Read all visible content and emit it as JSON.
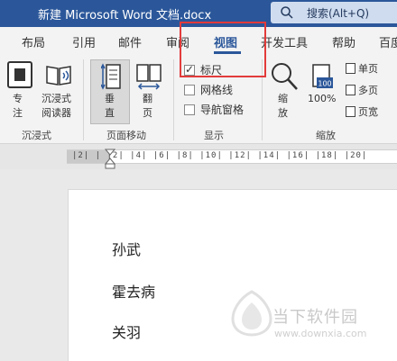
{
  "title_bar": {
    "document_title": "新建 Microsoft Word 文档.docx",
    "search_placeholder": "搜索(Alt+Q)"
  },
  "tabs": [
    {
      "label": "布局"
    },
    {
      "label": "引用"
    },
    {
      "label": "邮件"
    },
    {
      "label": "审阅"
    },
    {
      "label": "视图",
      "active": true
    },
    {
      "label": "开发工具"
    },
    {
      "label": "帮助"
    },
    {
      "label": "百度"
    }
  ],
  "ribbon": {
    "immersive": {
      "focus_line1": "专",
      "focus_line2": "注",
      "reader_line1": "沉浸式",
      "reader_line2": "阅读器",
      "group_label": "沉浸式"
    },
    "page_movement": {
      "vertical_line1": "垂",
      "vertical_line2": "直",
      "flip_line1": "翻",
      "flip_line2": "页",
      "group_label": "页面移动"
    },
    "show": {
      "ruler": "标尺",
      "ruler_checked": true,
      "gridlines": "网格线",
      "gridlines_checked": false,
      "nav_pane": "导航窗格",
      "nav_pane_checked": false,
      "group_label": "显示"
    },
    "zoom": {
      "zoom_line1": "缩",
      "zoom_line2": "放",
      "hundred_badge": "100",
      "hundred_label": "100%",
      "one_page": "单页",
      "multi_page": "多页",
      "page_width": "页宽",
      "group_label": "缩放"
    }
  },
  "ruler": {
    "numbers": "|2| |  |2| |4| |6| |8| |10| |12| |14| |16| |18| |20|"
  },
  "document": {
    "lines": [
      "孙武",
      "霍去病",
      "关羽"
    ]
  },
  "watermark": {
    "text": "当下软件园",
    "url": "www.downxia.com"
  },
  "colors": {
    "title_bar": "#2b579a",
    "highlight": "#e23b3b",
    "accent": "#2b579a"
  }
}
